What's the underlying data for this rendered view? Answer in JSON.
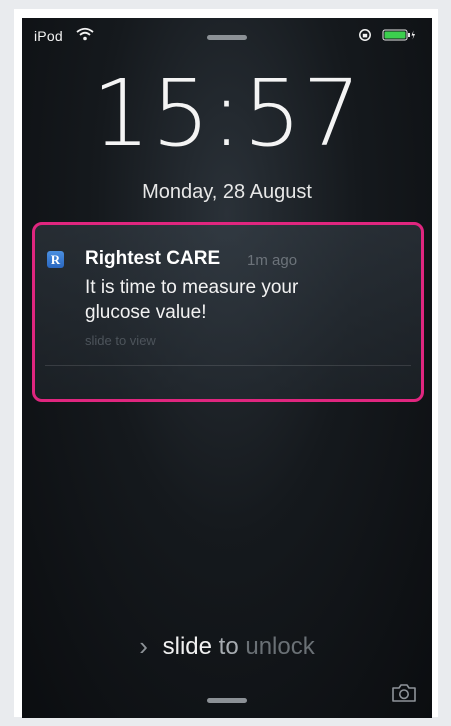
{
  "status_bar": {
    "carrier": "iPod",
    "icons": [
      "wifi-icon",
      "lock-rotation-icon",
      "battery-icon"
    ]
  },
  "lock_screen": {
    "time": "15:57",
    "date": "Monday, 28 August"
  },
  "notification": {
    "app_icon_letter": "R",
    "app_name": "Rightest CARE",
    "time_ago": "1m ago",
    "message_line1": "It is time to measure your",
    "message_line2": "glucose value!",
    "hint": "slide to view",
    "highlight_color": "#e0267f"
  },
  "unlock": {
    "chevron": "›",
    "word1": "slide",
    "word2": "to",
    "word3": "unlock"
  },
  "controls": {
    "camera": "camera-icon"
  },
  "colors": {
    "background": "#15191d",
    "battery": "#3ccf4e",
    "app_icon": "#2a67c0"
  }
}
